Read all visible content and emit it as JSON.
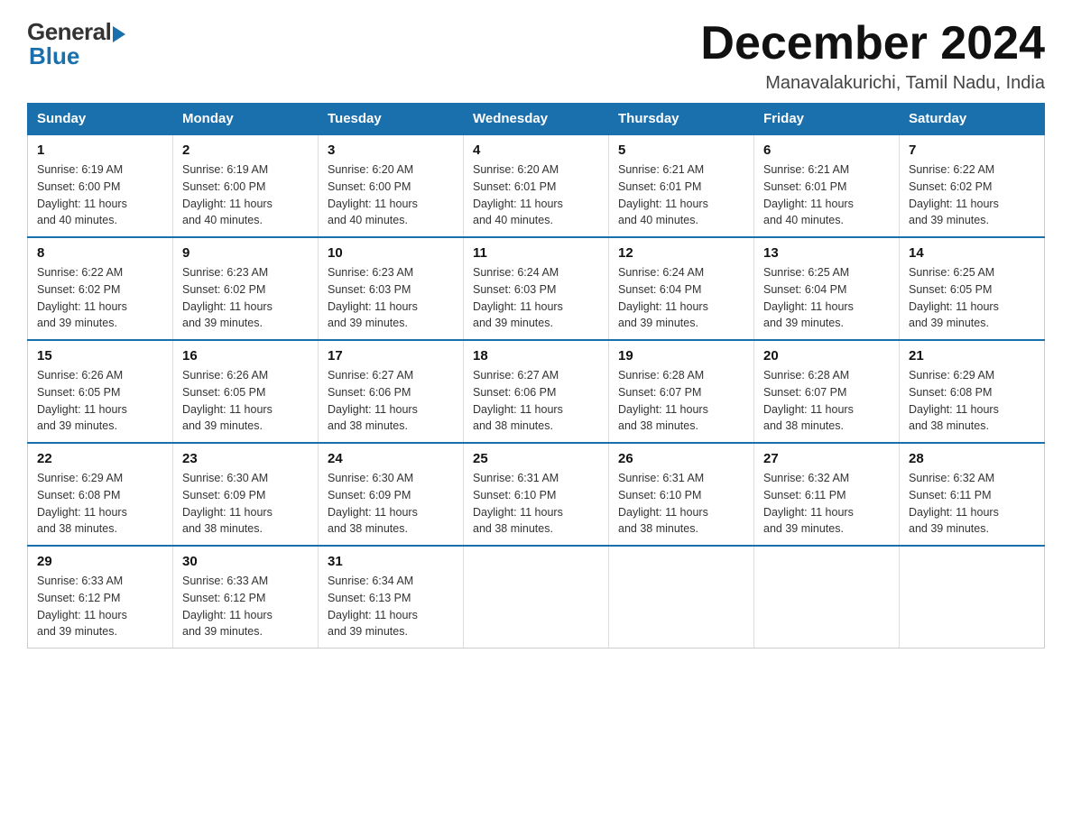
{
  "header": {
    "logo_general": "General",
    "logo_blue": "Blue",
    "title": "December 2024",
    "location": "Manavalakurichi, Tamil Nadu, India"
  },
  "days_of_week": [
    "Sunday",
    "Monday",
    "Tuesday",
    "Wednesday",
    "Thursday",
    "Friday",
    "Saturday"
  ],
  "weeks": [
    [
      {
        "day": "1",
        "sunrise": "6:19 AM",
        "sunset": "6:00 PM",
        "daylight": "11 hours and 40 minutes."
      },
      {
        "day": "2",
        "sunrise": "6:19 AM",
        "sunset": "6:00 PM",
        "daylight": "11 hours and 40 minutes."
      },
      {
        "day": "3",
        "sunrise": "6:20 AM",
        "sunset": "6:00 PM",
        "daylight": "11 hours and 40 minutes."
      },
      {
        "day": "4",
        "sunrise": "6:20 AM",
        "sunset": "6:01 PM",
        "daylight": "11 hours and 40 minutes."
      },
      {
        "day": "5",
        "sunrise": "6:21 AM",
        "sunset": "6:01 PM",
        "daylight": "11 hours and 40 minutes."
      },
      {
        "day": "6",
        "sunrise": "6:21 AM",
        "sunset": "6:01 PM",
        "daylight": "11 hours and 40 minutes."
      },
      {
        "day": "7",
        "sunrise": "6:22 AM",
        "sunset": "6:02 PM",
        "daylight": "11 hours and 39 minutes."
      }
    ],
    [
      {
        "day": "8",
        "sunrise": "6:22 AM",
        "sunset": "6:02 PM",
        "daylight": "11 hours and 39 minutes."
      },
      {
        "day": "9",
        "sunrise": "6:23 AM",
        "sunset": "6:02 PM",
        "daylight": "11 hours and 39 minutes."
      },
      {
        "day": "10",
        "sunrise": "6:23 AM",
        "sunset": "6:03 PM",
        "daylight": "11 hours and 39 minutes."
      },
      {
        "day": "11",
        "sunrise": "6:24 AM",
        "sunset": "6:03 PM",
        "daylight": "11 hours and 39 minutes."
      },
      {
        "day": "12",
        "sunrise": "6:24 AM",
        "sunset": "6:04 PM",
        "daylight": "11 hours and 39 minutes."
      },
      {
        "day": "13",
        "sunrise": "6:25 AM",
        "sunset": "6:04 PM",
        "daylight": "11 hours and 39 minutes."
      },
      {
        "day": "14",
        "sunrise": "6:25 AM",
        "sunset": "6:05 PM",
        "daylight": "11 hours and 39 minutes."
      }
    ],
    [
      {
        "day": "15",
        "sunrise": "6:26 AM",
        "sunset": "6:05 PM",
        "daylight": "11 hours and 39 minutes."
      },
      {
        "day": "16",
        "sunrise": "6:26 AM",
        "sunset": "6:05 PM",
        "daylight": "11 hours and 39 minutes."
      },
      {
        "day": "17",
        "sunrise": "6:27 AM",
        "sunset": "6:06 PM",
        "daylight": "11 hours and 38 minutes."
      },
      {
        "day": "18",
        "sunrise": "6:27 AM",
        "sunset": "6:06 PM",
        "daylight": "11 hours and 38 minutes."
      },
      {
        "day": "19",
        "sunrise": "6:28 AM",
        "sunset": "6:07 PM",
        "daylight": "11 hours and 38 minutes."
      },
      {
        "day": "20",
        "sunrise": "6:28 AM",
        "sunset": "6:07 PM",
        "daylight": "11 hours and 38 minutes."
      },
      {
        "day": "21",
        "sunrise": "6:29 AM",
        "sunset": "6:08 PM",
        "daylight": "11 hours and 38 minutes."
      }
    ],
    [
      {
        "day": "22",
        "sunrise": "6:29 AM",
        "sunset": "6:08 PM",
        "daylight": "11 hours and 38 minutes."
      },
      {
        "day": "23",
        "sunrise": "6:30 AM",
        "sunset": "6:09 PM",
        "daylight": "11 hours and 38 minutes."
      },
      {
        "day": "24",
        "sunrise": "6:30 AM",
        "sunset": "6:09 PM",
        "daylight": "11 hours and 38 minutes."
      },
      {
        "day": "25",
        "sunrise": "6:31 AM",
        "sunset": "6:10 PM",
        "daylight": "11 hours and 38 minutes."
      },
      {
        "day": "26",
        "sunrise": "6:31 AM",
        "sunset": "6:10 PM",
        "daylight": "11 hours and 38 minutes."
      },
      {
        "day": "27",
        "sunrise": "6:32 AM",
        "sunset": "6:11 PM",
        "daylight": "11 hours and 39 minutes."
      },
      {
        "day": "28",
        "sunrise": "6:32 AM",
        "sunset": "6:11 PM",
        "daylight": "11 hours and 39 minutes."
      }
    ],
    [
      {
        "day": "29",
        "sunrise": "6:33 AM",
        "sunset": "6:12 PM",
        "daylight": "11 hours and 39 minutes."
      },
      {
        "day": "30",
        "sunrise": "6:33 AM",
        "sunset": "6:12 PM",
        "daylight": "11 hours and 39 minutes."
      },
      {
        "day": "31",
        "sunrise": "6:34 AM",
        "sunset": "6:13 PM",
        "daylight": "11 hours and 39 minutes."
      },
      null,
      null,
      null,
      null
    ]
  ],
  "labels": {
    "sunrise": "Sunrise:",
    "sunset": "Sunset:",
    "daylight": "Daylight:"
  }
}
